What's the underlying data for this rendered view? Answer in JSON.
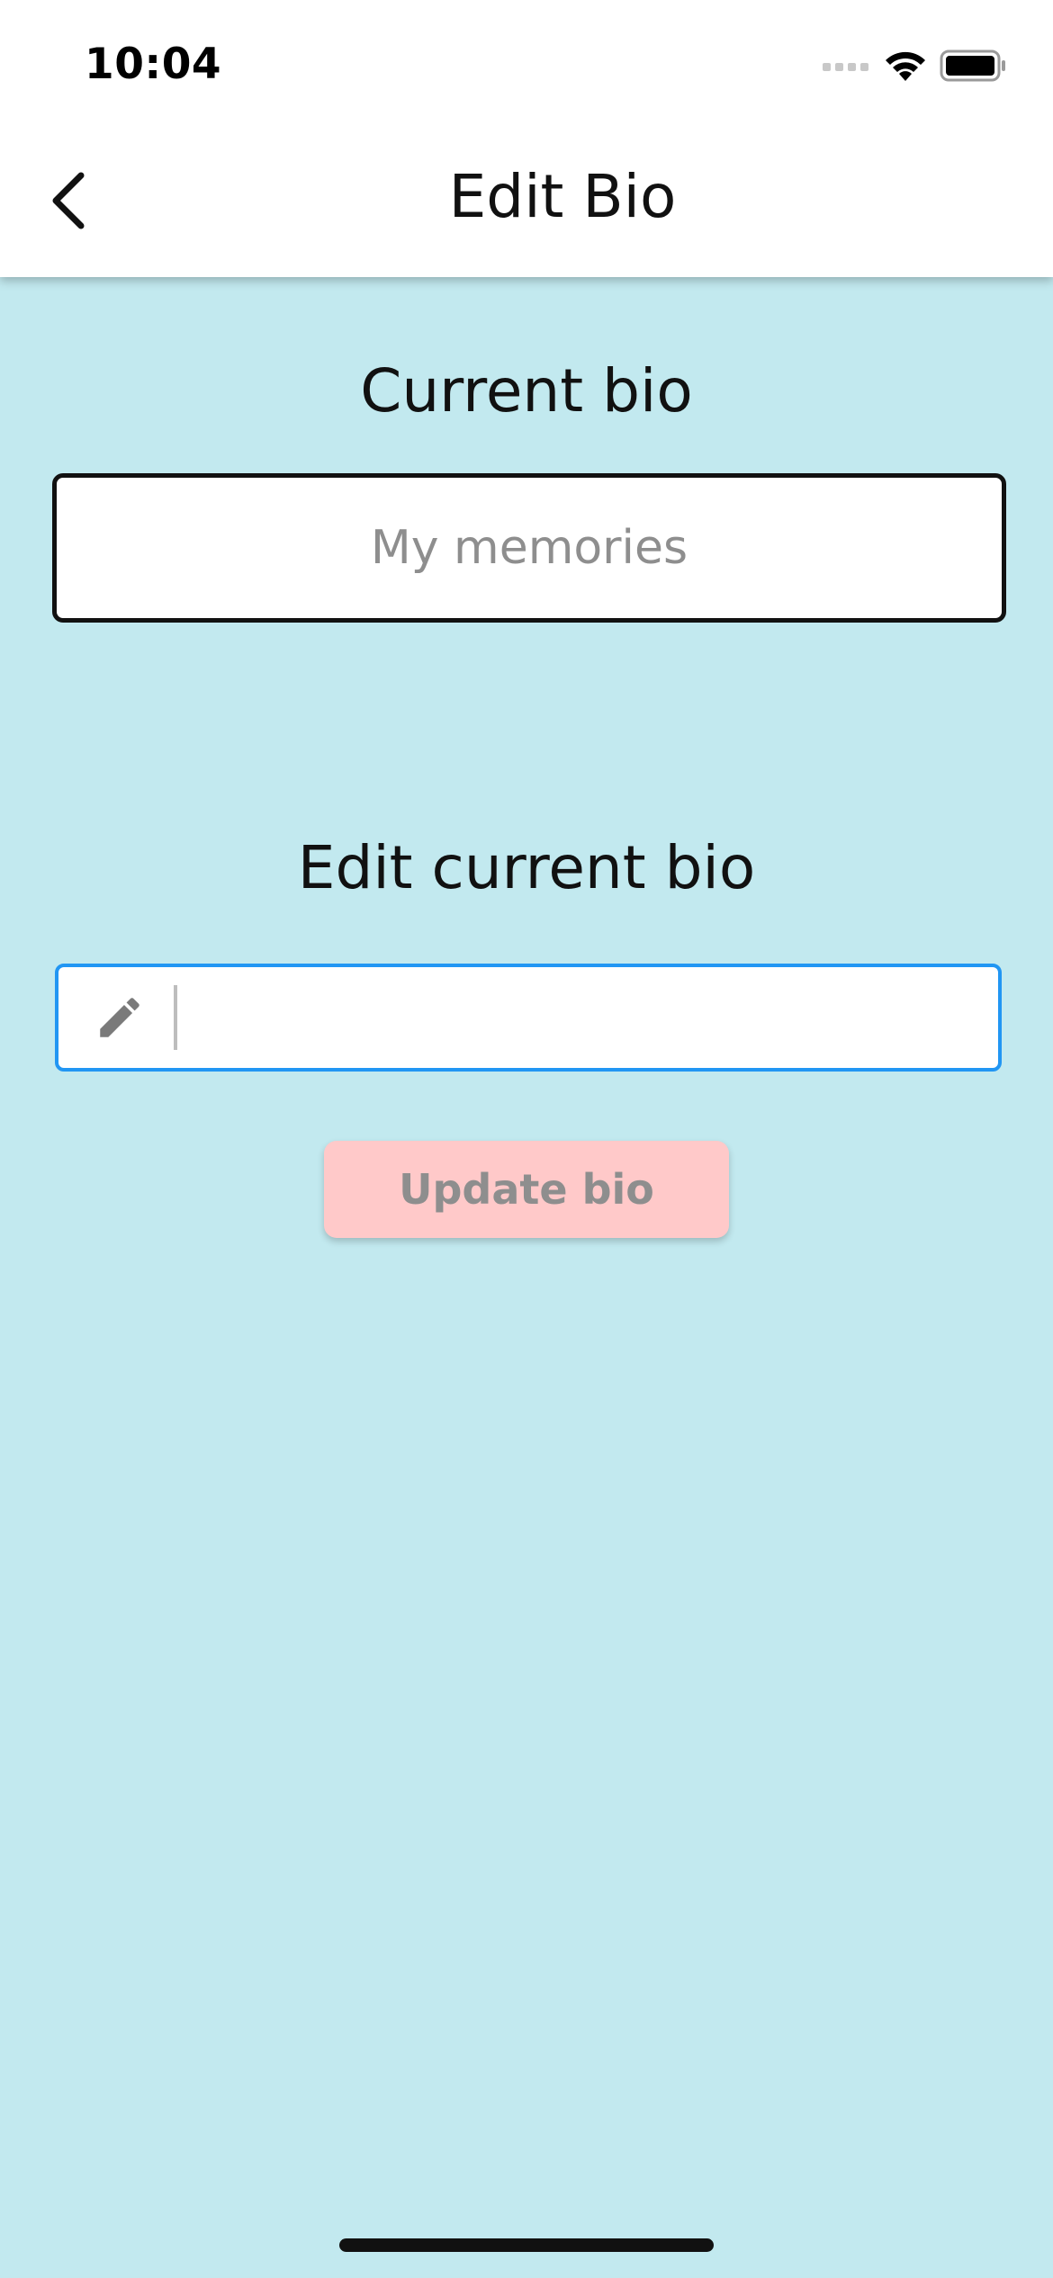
{
  "status_bar": {
    "time": "10:04",
    "icons": [
      "signal-icon",
      "wifi-icon",
      "battery-icon"
    ]
  },
  "nav": {
    "back_icon": "chevron-left-icon",
    "title": "Edit Bio"
  },
  "current_bio": {
    "label": "Current bio",
    "value": "My memories"
  },
  "edit_bio": {
    "label": "Edit current bio",
    "icon": "pencil-icon",
    "value": "",
    "placeholder": ""
  },
  "update_button": {
    "label": "Update bio"
  },
  "colors": {
    "background": "#c2e9ef",
    "input_focus_border": "#2196f3",
    "button_bg": "#ffc9c9",
    "muted_text": "#8e8e8e"
  }
}
